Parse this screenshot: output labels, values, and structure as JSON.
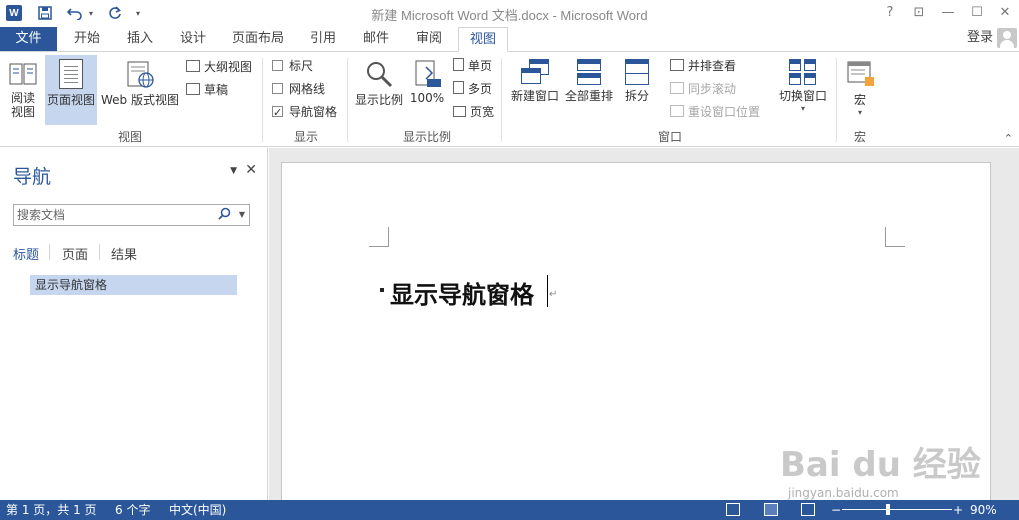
{
  "window": {
    "title": "新建 Microsoft Word 文档.docx - Microsoft Word",
    "logo_letter": "W",
    "help": "?",
    "ribbon_display": "⊡",
    "minimize": "—",
    "maximize": "☐",
    "close": "✕"
  },
  "quick_access": {
    "save_icon": "save-icon",
    "undo_icon": "undo-icon",
    "redo_icon": "redo-icon",
    "customize_icon": "chevron-down-icon"
  },
  "tabs": {
    "file": "文件",
    "items": [
      "开始",
      "插入",
      "设计",
      "页面布局",
      "引用",
      "邮件",
      "审阅",
      "视图"
    ],
    "active": "视图",
    "login": "登录"
  },
  "ribbon": {
    "views": {
      "label": "视图",
      "read_mode": "阅读\n视图",
      "read_mode_l1": "阅读",
      "read_mode_l2": "视图",
      "print_layout": "页面视图",
      "web_layout": "Web 版式视图",
      "outline": "大纲视图",
      "draft": "草稿"
    },
    "show": {
      "label": "显示",
      "ruler": "标尺",
      "ruler_checked": false,
      "gridlines": "网格线",
      "gridlines_checked": false,
      "nav_pane": "导航窗格",
      "nav_pane_checked": true
    },
    "zoom": {
      "label": "显示比例",
      "zoom": "显示比例",
      "hundred": "100%",
      "one_page": "单页",
      "multiple_pages": "多页",
      "page_width": "页宽"
    },
    "window": {
      "label": "窗口",
      "new_window": "新建窗口",
      "arrange_all": "全部重排",
      "split": "拆分",
      "side_by_side": "并排查看",
      "sync_scroll": "同步滚动",
      "reset_position": "重设窗口位置",
      "switch_windows": "切换窗口"
    },
    "macros": {
      "label": "宏",
      "macros": "宏"
    },
    "colors": {
      "accent": "#2b579a",
      "selected": "#c5d6ee"
    }
  },
  "nav": {
    "title": "导航",
    "search_placeholder": "搜索文档",
    "tabs": [
      "标题",
      "页面",
      "结果"
    ],
    "active_tab": "标题",
    "headings": [
      "显示导航窗格"
    ]
  },
  "document": {
    "heading": "显示导航窗格",
    "para_mark": "↵"
  },
  "watermark": {
    "logo": "Bai du 经验",
    "url": "jingyan.baidu.com"
  },
  "status": {
    "page": "第 1 页，共 1 页",
    "words": "6 个字",
    "language": "中文(中国)",
    "zoom_minus": "−",
    "zoom_plus": "+",
    "zoom": "90%",
    "zoom_fraction": 0.9
  }
}
